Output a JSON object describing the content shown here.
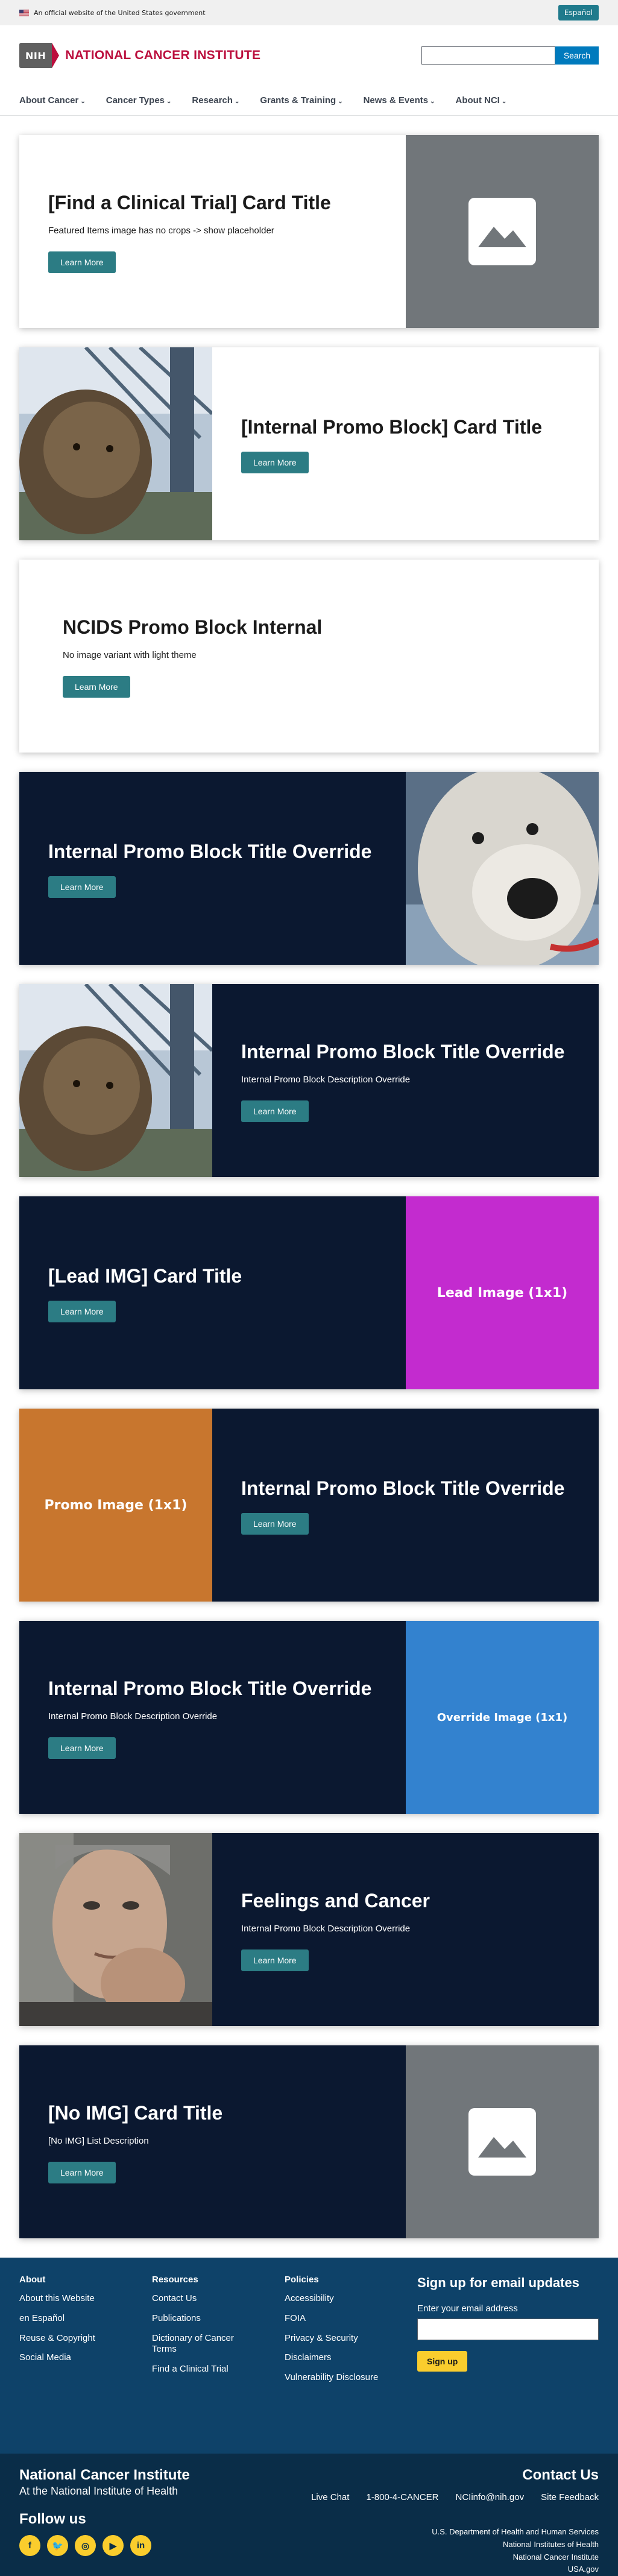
{
  "gov_banner": {
    "text": "An official website of the United States government",
    "espanol": "Español"
  },
  "header": {
    "nih": "NIH",
    "name": "NATIONAL CANCER INSTITUTE",
    "search_placeholder": "",
    "search_button": "Search"
  },
  "nav": [
    "About Cancer",
    "Cancer Types",
    "Research",
    "Grants & Training",
    "News & Events",
    "About NCI"
  ],
  "cards": [
    {
      "title": "[Find a Clinical Trial] Card Title",
      "description": "Featured Items image has no crops -> show placeholder",
      "button": "Learn More"
    },
    {
      "title": "[Internal Promo Block] Card Title",
      "description": "",
      "button": "Learn More"
    },
    {
      "title": "NCIDS Promo Block Internal",
      "description": "No image variant with light theme",
      "button": "Learn More"
    },
    {
      "title": "Internal Promo Block Title Override",
      "description": "",
      "button": "Learn More"
    },
    {
      "title": "Internal Promo Block Title Override",
      "description": "Internal Promo Block Description Override",
      "button": "Learn More"
    },
    {
      "title": "[Lead IMG] Card Title",
      "description": "",
      "button": "Learn More",
      "image_text": "Lead Image (1x1)",
      "image_color": "#c32bcf"
    },
    {
      "title": "Internal Promo Block Title Override",
      "description": "",
      "button": "Learn More",
      "image_text": "Promo Image (1x1)",
      "image_color": "#c8762e"
    },
    {
      "title": "Internal Promo Block Title Override",
      "description": "Internal Promo Block Description Override",
      "button": "Learn More",
      "image_text": "Override Image (1x1)",
      "image_color": "#3382cf"
    },
    {
      "title": "Feelings and Cancer",
      "description": "Internal Promo Block Description Override",
      "button": "Learn More"
    },
    {
      "title": "[No IMG] Card Title",
      "description": "[No IMG] List Description",
      "button": "Learn More"
    }
  ],
  "footer": {
    "about": {
      "heading": "About",
      "links": [
        "About this Website",
        "en Español",
        "Reuse & Copyright",
        "Social Media"
      ]
    },
    "resources": {
      "heading": "Resources",
      "links": [
        "Contact Us",
        "Publications",
        "Dictionary of Cancer Terms",
        "Find a Clinical Trial"
      ]
    },
    "policies": {
      "heading": "Policies",
      "links": [
        "Accessibility",
        "FOIA",
        "Privacy & Security",
        "Disclaimers",
        "Vulnerability Disclosure"
      ]
    },
    "signup": {
      "title": "Sign up for email updates",
      "label": "Enter your email address",
      "button": "Sign up"
    }
  },
  "subfooter": {
    "org": "National Cancer Institute",
    "org_sub": "At the National Institute of Health",
    "follow": "Follow us",
    "contact_title": "Contact Us",
    "contacts": [
      "Live Chat",
      "1-800-4-CANCER",
      "NCIinfo@nih.gov",
      "Site Feedback"
    ],
    "gov_links": [
      "U.S. Department of Health and Human Services",
      "National Institutes of Health",
      "National Cancer Institute",
      "USA.gov"
    ]
  },
  "colors": {
    "accent": "#2c7c84",
    "dark_card": "#0b1830",
    "brand_red": "#bb0e3d",
    "footer": "#0e4269"
  }
}
